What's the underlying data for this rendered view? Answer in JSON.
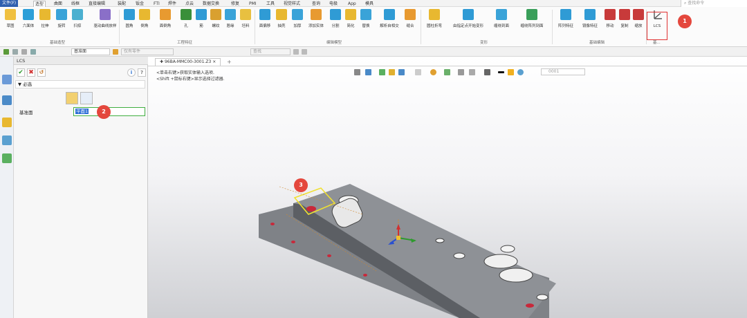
{
  "menu": {
    "file": "文件(F)",
    "items": [
      "造型",
      "曲面",
      "线框",
      "直接编辑",
      "装配",
      "钣金",
      "FTI",
      "焊件",
      "点云",
      "数据交换",
      "修复",
      "PMI",
      "工具",
      "视觉样式",
      "查询",
      "电极",
      "App",
      "模具"
    ],
    "active_index": 0
  },
  "search": {
    "placeholder": "查找命令"
  },
  "ribbon": {
    "groups": [
      {
        "label": "基础造型",
        "buttons": [
          "草图",
          "六面体",
          "拉伸",
          "旋转",
          "扫掠",
          "延伸",
          "驱动曲线放样"
        ]
      },
      {
        "label": "工程特征",
        "buttons": [
          "圆角",
          "倒角",
          "面倒角",
          "孔",
          "筋",
          "螺纹",
          "唇缘",
          "坯料"
        ]
      },
      {
        "label": "编辑模型",
        "buttons": [
          "面偏移",
          "抽壳",
          "加厚",
          "添加实体",
          "分割",
          "简化",
          "替换",
          "解析自相交",
          "缝合"
        ]
      },
      {
        "label": "变形",
        "buttons": [
          "圆柱折弯",
          "由指定点开始变形",
          "缠绕到面",
          "缠绕阵列到面"
        ]
      },
      {
        "label": "基础编辑",
        "buttons": [
          "阵列特征",
          "镜像特征",
          "移动",
          "复制",
          "缩放"
        ]
      },
      {
        "label": "基...",
        "buttons": [
          "LCS"
        ]
      }
    ]
  },
  "toolbar": {
    "combo_plane": "基准面",
    "combo_filter": "仅有零件",
    "combo_search": "查找"
  },
  "panel": {
    "title": "LCS",
    "section": "必选",
    "field_label": "基准面",
    "field_value": "平面1"
  },
  "viewport": {
    "tab_label": "96BA-MMC00-3001.Z3",
    "tab_add": "+",
    "hint_line1": "<单击右键>获取实体输入选项.",
    "hint_line2": "<Shift +鼠标右键>显示选择过滤器.",
    "filter_placeholder": "0001"
  },
  "callouts": [
    "1",
    "2",
    "3"
  ],
  "colors": {
    "file_menu": "#2f5faf",
    "callout": "#e4473d",
    "highlight": "#e03030",
    "selection": "#f0e030",
    "part": "#8a8d92"
  }
}
